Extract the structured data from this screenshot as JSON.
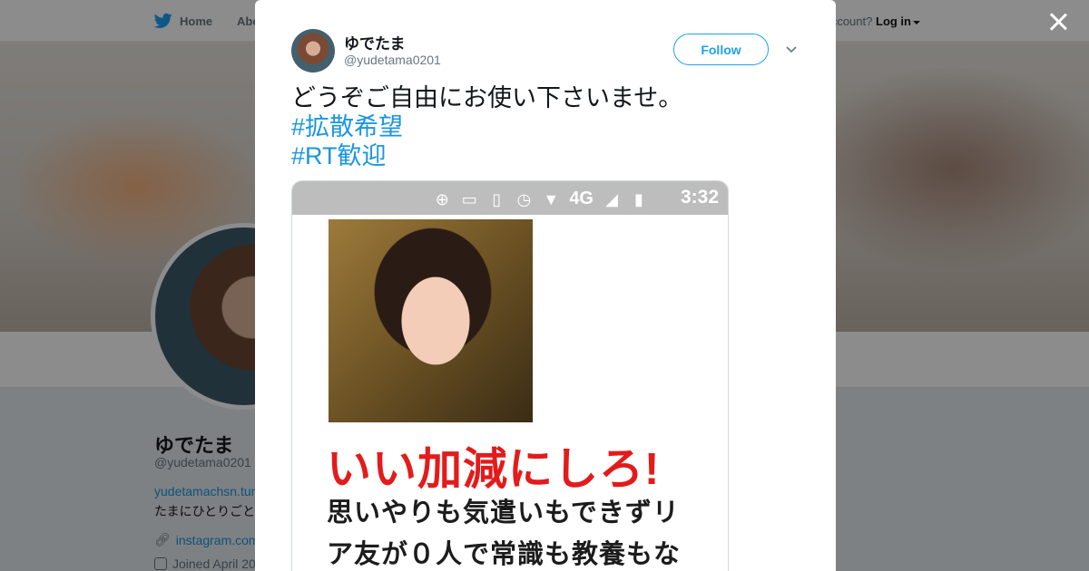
{
  "nav": {
    "home_label": "Home",
    "about_label": "Abo",
    "login_prompt": "ccount?",
    "login_label": "Log in"
  },
  "profile": {
    "name": "ゆでたま",
    "handle": "@yudetama0201",
    "link": "yudetamachsn.tum",
    "bio": "たまにひとりごと",
    "instagram": "instagram.com",
    "joined": "Joined April 20"
  },
  "tweet": {
    "author_name": "ゆでたま",
    "author_handle": "@yudetama0201",
    "follow_label": "Follow",
    "text": "どうぞご自由にお使い下さいませ。",
    "hashtags": [
      "#拡散希望",
      "#RT歓迎"
    ],
    "media": {
      "status_network": "4G",
      "status_time": "3:32",
      "headline": "いい加減にしろ!",
      "lines": [
        "思いやりも気遣いもできずリ",
        "ア友が０人で常識も教養もな"
      ]
    }
  },
  "colors": {
    "accent": "#1da1f2",
    "link": "#1b95e0",
    "headline_red": "#e31b1b"
  },
  "icons": [
    "twitter-bird-icon",
    "close-icon",
    "chevron-down-icon",
    "link-icon",
    "calendar-icon",
    "cast-icon",
    "vibrate-icon",
    "alarm-icon",
    "wifi-icon",
    "signal-icon",
    "battery-icon"
  ]
}
